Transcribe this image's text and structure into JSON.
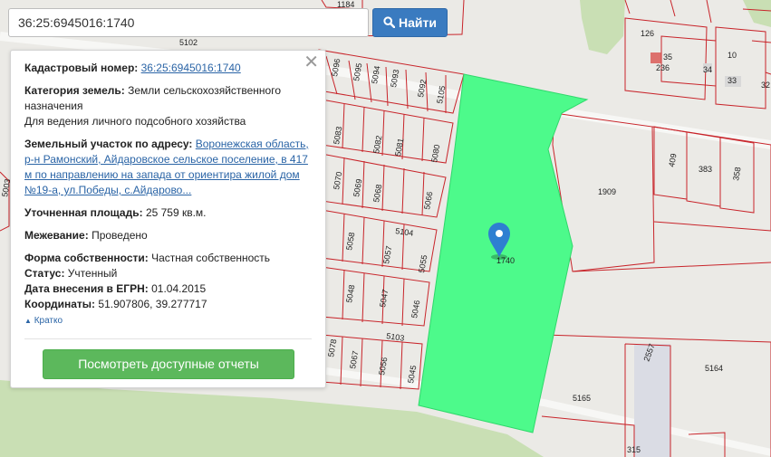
{
  "search": {
    "value": "36:25:6945016:1740",
    "button_label": "Найти",
    "button_icon": "search-icon"
  },
  "card": {
    "close_icon": "close-icon",
    "cadastral_label": "Кадастровый номер:",
    "cadastral_value": "36:25:6945016:1740",
    "category_label": "Категория земель:",
    "category_value": "Земли сельскохозяйственного назначения",
    "usage_value": "Для ведения личного подсобного хозяйства",
    "address_label": "Земельный участок по адресу:",
    "address_value": "Воронежская область, р-н Рамонский, Айдаровское сельское поселение, в 417 м по направлению на запада от ориентира жилой дом №19-а, ул.Победы, с.Айдарово...",
    "area_label": "Уточненная площадь:",
    "area_value": "25 759 кв.м.",
    "survey_label": "Межевание:",
    "survey_value": "Проведено",
    "ownership_label": "Форма собственности:",
    "ownership_value": "Частная собственность",
    "status_label": "Статус:",
    "status_value": "Учтенный",
    "date_label": "Дата внесения в ЕГРН:",
    "date_value": "01.04.2015",
    "coords_label": "Координаты:",
    "coords_value": "51.907806, 39.277717",
    "toggle_label": "Кратко",
    "report_button": "Посмотреть доступные отчеты"
  },
  "map": {
    "selected_label": "1740",
    "colors": {
      "selected_fill": "#4dfa8b",
      "parcel_border": "#c8242a",
      "marker": "#2e7fd1",
      "search_button": "#3a7bc0",
      "report_button": "#5cb85c",
      "link": "#2a64a6"
    },
    "parcel_labels": [
      "1184",
      "5102",
      "5096",
      "5095",
      "5094",
      "5093",
      "5092",
      "5105",
      "5083",
      "5082",
      "5081",
      "5080",
      "5070",
      "5069",
      "5068",
      "5066",
      "5104",
      "5058",
      "5057",
      "5055",
      "5048",
      "5047",
      "5046",
      "5103",
      "5078",
      "5067",
      "5056",
      "5045",
      "126",
      "35",
      "236",
      "34",
      "10",
      "33",
      "32",
      "409",
      "383",
      "358",
      "1909",
      "2557",
      "5164",
      "5165",
      "315",
      "5003"
    ]
  }
}
